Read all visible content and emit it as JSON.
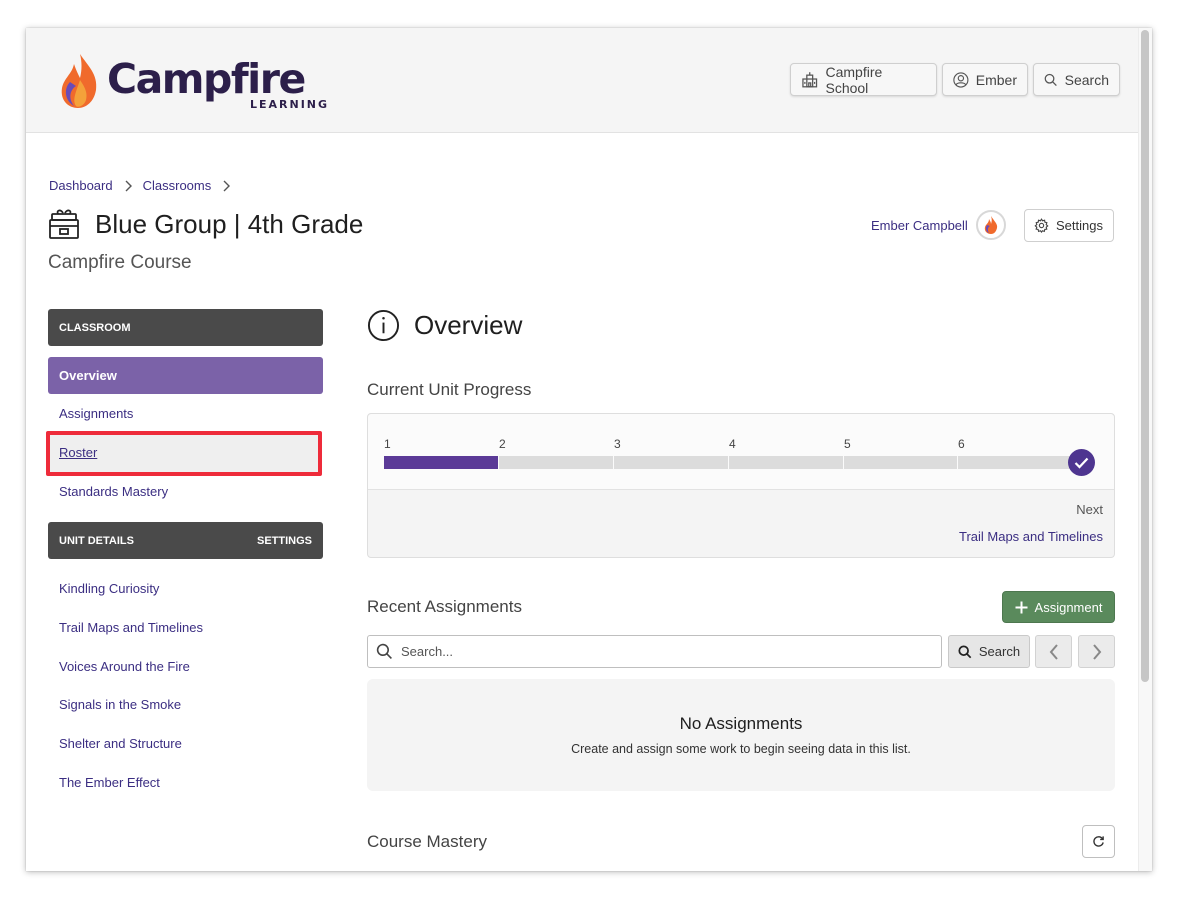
{
  "header": {
    "logo": {
      "word": "Campfire",
      "sub": "LEARNING"
    },
    "school_button": "Campfire School",
    "user_button": "Ember",
    "search_button": "Search"
  },
  "breadcrumb": [
    "Dashboard",
    "Classrooms"
  ],
  "page": {
    "title": "Blue Group | 4th Grade",
    "subtitle": "Campfire Course",
    "teacher_name": "Ember Campbell",
    "settings_button": "Settings"
  },
  "sidebar": {
    "classroom_header": "CLASSROOM",
    "classroom_items": [
      {
        "label": "Overview",
        "active": true
      },
      {
        "label": "Assignments",
        "active": false
      },
      {
        "label": "Roster",
        "active": false,
        "highlighted": true
      },
      {
        "label": "Standards Mastery",
        "active": false
      }
    ],
    "unit_header": "UNIT DETAILS",
    "unit_header_action": "SETTINGS",
    "units": [
      "Kindling Curiosity",
      "Trail Maps and Timelines",
      "Voices Around the Fire",
      "Signals in the Smoke",
      "Shelter and Structure",
      "The Ember Effect"
    ]
  },
  "overview": {
    "title": "Overview",
    "progress": {
      "title": "Current Unit Progress",
      "steps": [
        "1",
        "2",
        "3",
        "4",
        "5",
        "6"
      ],
      "completed_steps": 1,
      "next_label": "Next",
      "next_unit": "Trail Maps and Timelines"
    },
    "assignments": {
      "title": "Recent Assignments",
      "add_button": "Assignment",
      "search_placeholder": "Search...",
      "search_button": "Search",
      "empty_title": "No Assignments",
      "empty_desc": "Create and assign some work to begin seeing data in this list."
    },
    "mastery": {
      "title": "Course Mastery"
    }
  },
  "colors": {
    "brand_purple": "#5b3a97",
    "link": "#3b2e82",
    "active_nav": "#7b62a8",
    "add_green": "#5a8a5c",
    "highlight_red": "#ee2b3a"
  }
}
